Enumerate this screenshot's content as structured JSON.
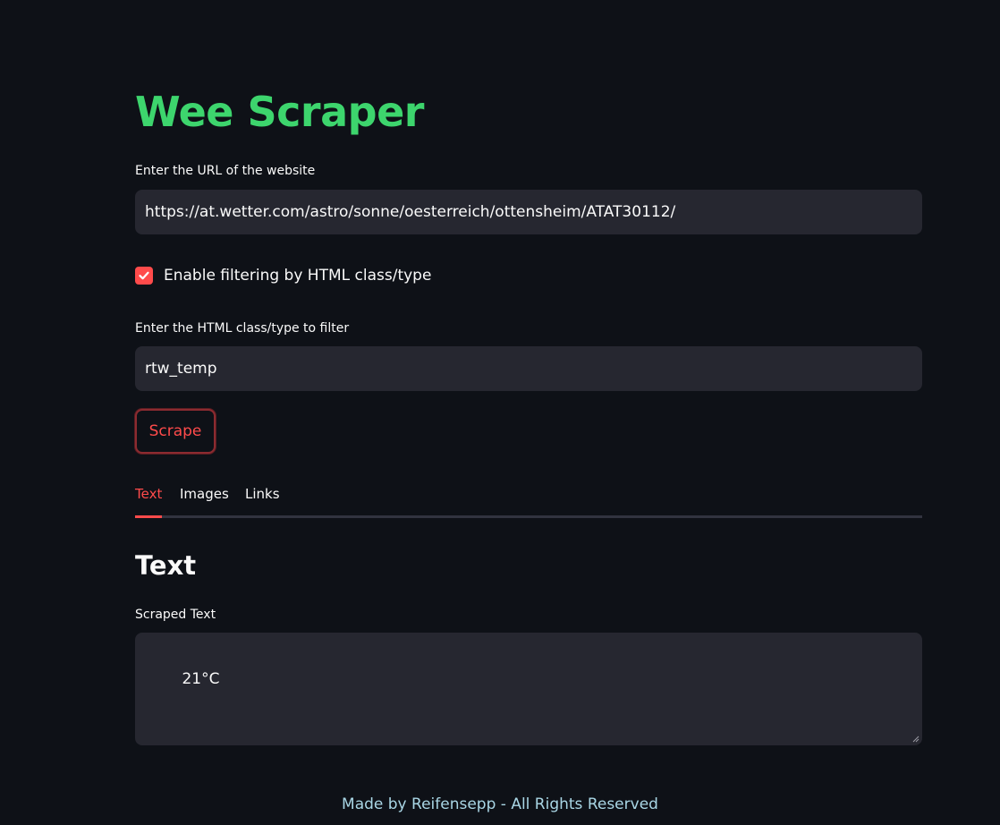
{
  "app": {
    "title": "Wee Scraper"
  },
  "url_input": {
    "label": "Enter the URL of the website",
    "value": "https://at.wetter.com/astro/sonne/oesterreich/ottensheim/ATAT30112/"
  },
  "filter_toggle": {
    "label": "Enable filtering by HTML class/type",
    "checked": true,
    "icon": "check-icon"
  },
  "filter_input": {
    "label": "Enter the HTML class/type to filter",
    "value": "rtw_temp"
  },
  "scrape_button": {
    "label": "Scrape"
  },
  "tabs": [
    {
      "label": "Text",
      "active": true
    },
    {
      "label": "Images",
      "active": false
    },
    {
      "label": "Links",
      "active": false
    }
  ],
  "text_panel": {
    "heading": "Text",
    "output_label": "Scraped Text",
    "output_value": "21°C"
  },
  "footer": {
    "text": "Made by Reifensepp - All Rights Reserved"
  },
  "colors": {
    "background": "#0e1117",
    "title_green": "#3dd56d",
    "accent_red": "#ff4b4b",
    "input_bg": "#262730",
    "footer_text": "#a9d6e5"
  }
}
